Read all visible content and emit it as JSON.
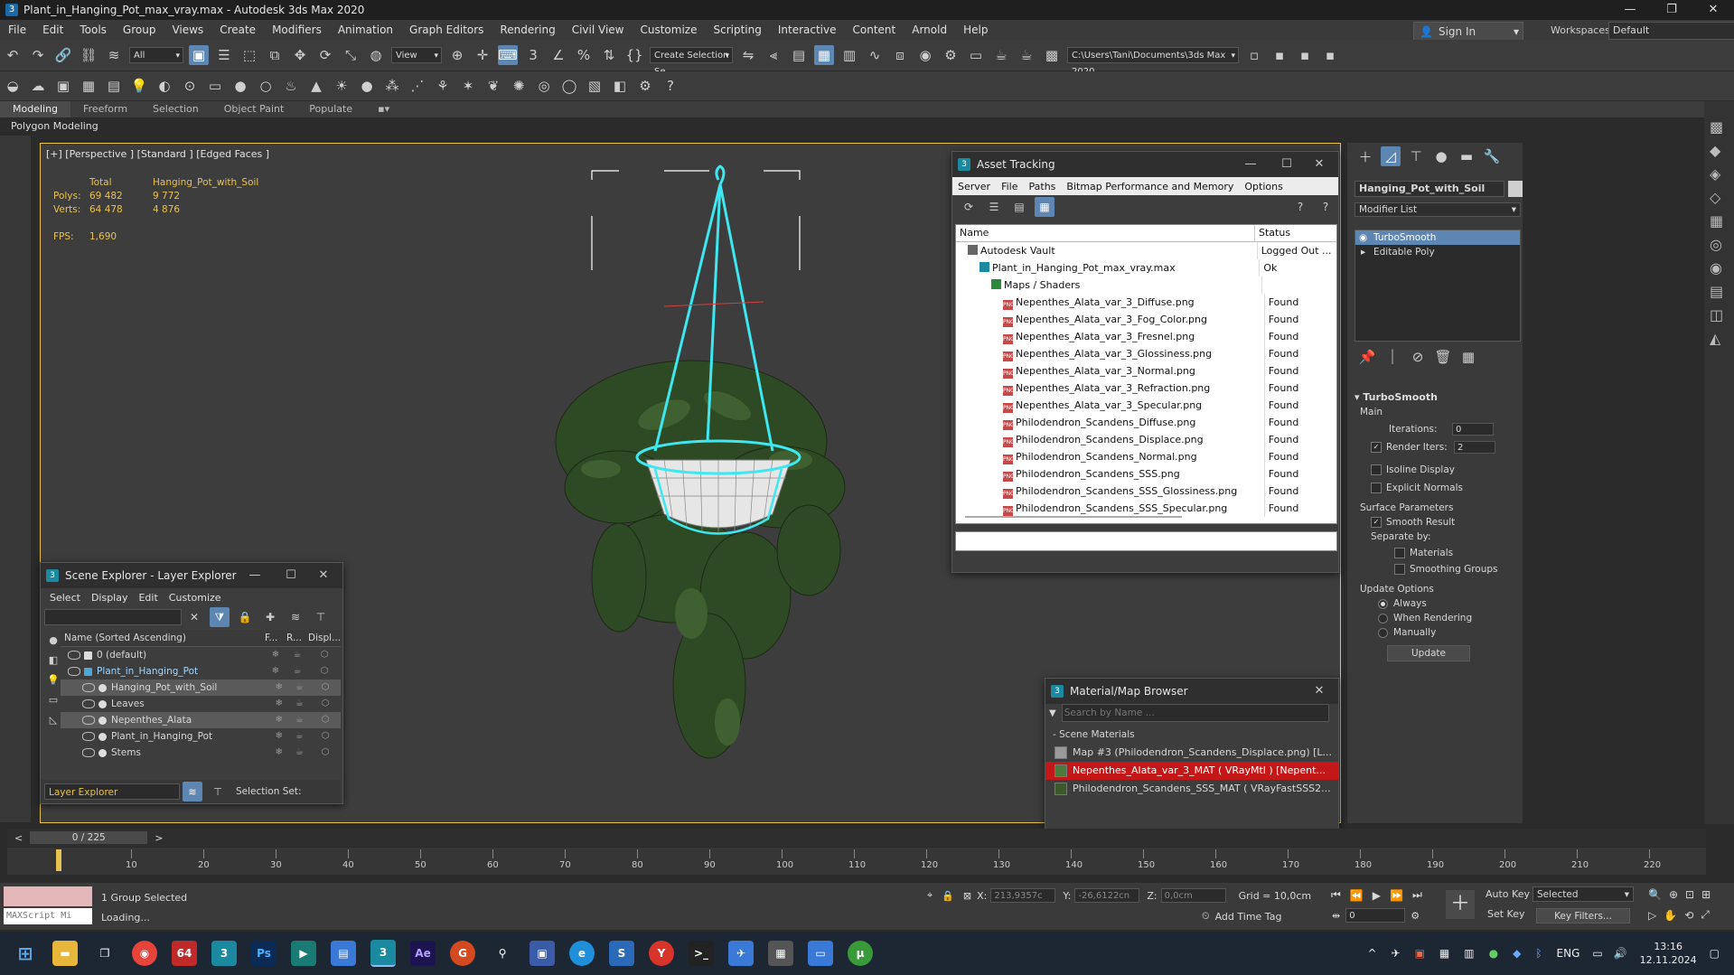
{
  "window": {
    "title": "Plant_in_Hanging_Pot_max_vray.max - Autodesk 3ds Max 2020"
  },
  "menu": [
    "File",
    "Edit",
    "Tools",
    "Group",
    "Views",
    "Create",
    "Modifiers",
    "Animation",
    "Graph Editors",
    "Rendering",
    "Civil View",
    "Customize",
    "Scripting",
    "Interactive",
    "Content",
    "Arnold",
    "Help"
  ],
  "signin": {
    "label": "Sign In"
  },
  "workspaces": {
    "label": "Workspaces:",
    "value": "Default"
  },
  "toolbar": {
    "filter": "All",
    "refcoord": "View",
    "selection_set": "Create Selection Se",
    "path": "C:\\Users\\Tani\\Documents\\3ds Max 2020"
  },
  "ribbon": {
    "tabs": [
      "Modeling",
      "Freeform",
      "Selection",
      "Object Paint",
      "Populate"
    ],
    "active": "Modeling",
    "sub": "Polygon Modeling"
  },
  "viewport": {
    "label": "[+] [Perspective ] [Standard ] [Edged Faces ]",
    "stats": {
      "col_total": "Total",
      "col_obj": "Hanging_Pot_with_Soil",
      "polys_label": "Polys:",
      "polys_total": "69 482",
      "polys_obj": "9 772",
      "verts_label": "Verts:",
      "verts_total": "64 478",
      "verts_obj": "4 876",
      "fps_label": "FPS:",
      "fps": "1,690"
    }
  },
  "asset_tracking": {
    "title": "Asset Tracking",
    "menu": [
      "Server",
      "File",
      "Paths",
      "Bitmap Performance and Memory",
      "Options"
    ],
    "col_name": "Name",
    "col_status": "Status",
    "rows": [
      {
        "name": "Autodesk Vault",
        "status": "Logged Out ...",
        "indent": 1,
        "kind": "vault"
      },
      {
        "name": "Plant_in_Hanging_Pot_max_vray.max",
        "status": "Ok",
        "indent": 2,
        "kind": "max"
      },
      {
        "name": "Maps / Shaders",
        "status": "",
        "indent": 3,
        "kind": "maps"
      },
      {
        "name": "Nepenthes_Alata_var_3_Diffuse.png",
        "status": "Found",
        "indent": 4,
        "kind": "png"
      },
      {
        "name": "Nepenthes_Alata_var_3_Fog_Color.png",
        "status": "Found",
        "indent": 4,
        "kind": "png"
      },
      {
        "name": "Nepenthes_Alata_var_3_Fresnel.png",
        "status": "Found",
        "indent": 4,
        "kind": "png"
      },
      {
        "name": "Nepenthes_Alata_var_3_Glossiness.png",
        "status": "Found",
        "indent": 4,
        "kind": "png"
      },
      {
        "name": "Nepenthes_Alata_var_3_Normal.png",
        "status": "Found",
        "indent": 4,
        "kind": "png"
      },
      {
        "name": "Nepenthes_Alata_var_3_Refraction.png",
        "status": "Found",
        "indent": 4,
        "kind": "png"
      },
      {
        "name": "Nepenthes_Alata_var_3_Specular.png",
        "status": "Found",
        "indent": 4,
        "kind": "png"
      },
      {
        "name": "Philodendron_Scandens_Diffuse.png",
        "status": "Found",
        "indent": 4,
        "kind": "png"
      },
      {
        "name": "Philodendron_Scandens_Displace.png",
        "status": "Found",
        "indent": 4,
        "kind": "png"
      },
      {
        "name": "Philodendron_Scandens_Normal.png",
        "status": "Found",
        "indent": 4,
        "kind": "png"
      },
      {
        "name": "Philodendron_Scandens_SSS.png",
        "status": "Found",
        "indent": 4,
        "kind": "png"
      },
      {
        "name": "Philodendron_Scandens_SSS_Glossiness.png",
        "status": "Found",
        "indent": 4,
        "kind": "png"
      },
      {
        "name": "Philodendron_Scandens_SSS_Specular.png",
        "status": "Found",
        "indent": 4,
        "kind": "png"
      }
    ]
  },
  "scene_explorer": {
    "title": "Scene Explorer - Layer Explorer",
    "menu": [
      "Select",
      "Display",
      "Edit",
      "Customize"
    ],
    "col_name": "Name (Sorted Ascending)",
    "col_f": "F...",
    "col_r": "R...",
    "col_d": "Displ...",
    "rows": [
      {
        "name": "0 (default)",
        "indent": 0,
        "selected": false
      },
      {
        "name": "Plant_in_Hanging_Pot",
        "indent": 0,
        "selected": false,
        "blue": true
      },
      {
        "name": "Hanging_Pot_with_Soil",
        "indent": 1,
        "selected": true
      },
      {
        "name": "Leaves",
        "indent": 1,
        "selected": false
      },
      {
        "name": "Nepenthes_Alata",
        "indent": 1,
        "selected": true
      },
      {
        "name": "Plant_in_Hanging_Pot",
        "indent": 1,
        "selected": false
      },
      {
        "name": "Stems",
        "indent": 1,
        "selected": false
      }
    ],
    "footer_explorer": "Layer Explorer",
    "footer_selset": "Selection Set:"
  },
  "command_panel": {
    "object_name": "Hanging_Pot_with_Soil",
    "modifier_list": "Modifier List",
    "stack": [
      "TurboSmooth",
      "Editable Poly"
    ],
    "rollout_title": "TurboSmooth",
    "main_label": "Main",
    "iterations_label": "Iterations:",
    "iterations": "0",
    "render_iters_label": "Render Iters:",
    "render_iters": "2",
    "isoline": "Isoline Display",
    "explicit_normals": "Explicit Normals",
    "surface_params": "Surface Parameters",
    "smooth_result": "Smooth Result",
    "separate_by": "Separate by:",
    "materials": "Materials",
    "smoothing_groups": "Smoothing Groups",
    "update_options": "Update Options",
    "always": "Always",
    "when_rendering": "When Rendering",
    "manually": "Manually",
    "update_btn": "Update"
  },
  "material_browser": {
    "title": "Material/Map Browser",
    "search_placeholder": "Search by Name ...",
    "group": "- Scene Materials",
    "items": [
      {
        "name": "Map #3 (Philodendron_Scandens_Displace.png) [L...",
        "highlight": false,
        "swatch": "#9a9a9a"
      },
      {
        "name": "Nepenthes_Alata_var_3_MAT  ( VRayMtl )  [Nepent...",
        "highlight": true,
        "swatch": "#4d7a3a"
      },
      {
        "name": "Philodendron_Scandens_SSS_MAT  ( VRayFastSSS2...",
        "highlight": false,
        "swatch": "#3b5a2a"
      }
    ]
  },
  "timeline": {
    "frame": "0 / 225",
    "ticks": [
      "10",
      "20",
      "30",
      "40",
      "50",
      "60",
      "70",
      "80",
      "90",
      "100",
      "110",
      "120",
      "130",
      "140",
      "150",
      "160",
      "170",
      "180",
      "190",
      "200",
      "210",
      "220"
    ]
  },
  "status": {
    "maxscript": "MAXScript Mi",
    "selected": "1 Group Selected",
    "loading": "Loading...",
    "x_label": "X:",
    "x": "213,9357c",
    "y_label": "Y:",
    "y": "-26,6122cn",
    "z_label": "Z:",
    "z": "0,0cm",
    "grid": "Grid = 10,0cm",
    "add_time_tag": "Add Time Tag",
    "auto_key": "Auto Key",
    "set_key": "Set Key",
    "selected_dd": "Selected",
    "key_filters": "Key Filters...",
    "frame_num": "0"
  },
  "taskbar": {
    "lang": "ENG",
    "time": "13:16",
    "date": "12.11.2024"
  },
  "colors": {
    "accent": "#5d86b3",
    "viewport_border": "#e8c250",
    "cyan_wire": "#3fe7f0"
  }
}
